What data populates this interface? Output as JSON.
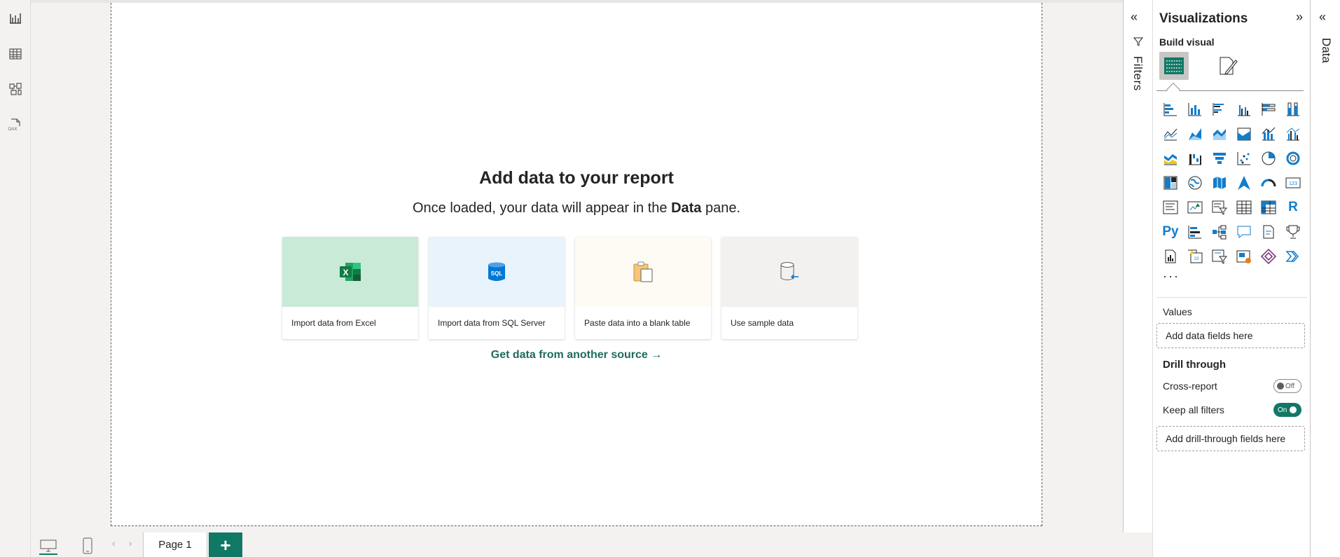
{
  "rail": {
    "items": [
      {
        "name": "report-view",
        "icon": "bar-chart-icon"
      },
      {
        "name": "table-view",
        "icon": "table-icon"
      },
      {
        "name": "model-view",
        "icon": "model-icon"
      },
      {
        "name": "dax-query-view",
        "icon": "dax-icon",
        "label": "DAX"
      }
    ]
  },
  "canvas": {
    "title": "Add data to your report",
    "subtitle_before": "Once loaded, your data will appear in the ",
    "subtitle_bold": "Data",
    "subtitle_after": " pane.",
    "cards": [
      {
        "label": "Import data from Excel",
        "icon": "excel-icon",
        "color": "#c8ead6"
      },
      {
        "label": "Import data from SQL Server",
        "icon": "sql-icon",
        "color": "#e9f3fc"
      },
      {
        "label": "Paste data into a blank table",
        "icon": "clipboard-icon",
        "color": "#fdfbf3"
      },
      {
        "label": "Use sample data",
        "icon": "database-icon",
        "color": "#f2f1f0"
      }
    ],
    "get_data_link": "Get data from another source →",
    "sql_badge": "SQL",
    "excel_badge": "X"
  },
  "bottom": {
    "prev": "‹",
    "next": "›",
    "page_tab": "Page 1",
    "add_page": "+"
  },
  "filters": {
    "collapse_glyph": "«",
    "label": "Filters"
  },
  "visualizations": {
    "title": "Visualizations",
    "collapse_glyph": "»",
    "build_visual": "Build visual",
    "more": "···",
    "values_label": "Values",
    "values_well": "Add data fields here",
    "drill_title": "Drill through",
    "cross_report_label": "Cross-report",
    "cross_report_state": "Off",
    "keep_filters_label": "Keep all filters",
    "keep_filters_state": "On",
    "drill_well": "Add drill-through fields here",
    "r_visual": "R",
    "py_visual": "Py",
    "card_visual": "123"
  },
  "data_pane": {
    "collapse_glyph": "«",
    "label": "Data"
  },
  "colors": {
    "accent": "#117865",
    "link": "#1f6b5c",
    "viz_blue": "#117dcd"
  }
}
